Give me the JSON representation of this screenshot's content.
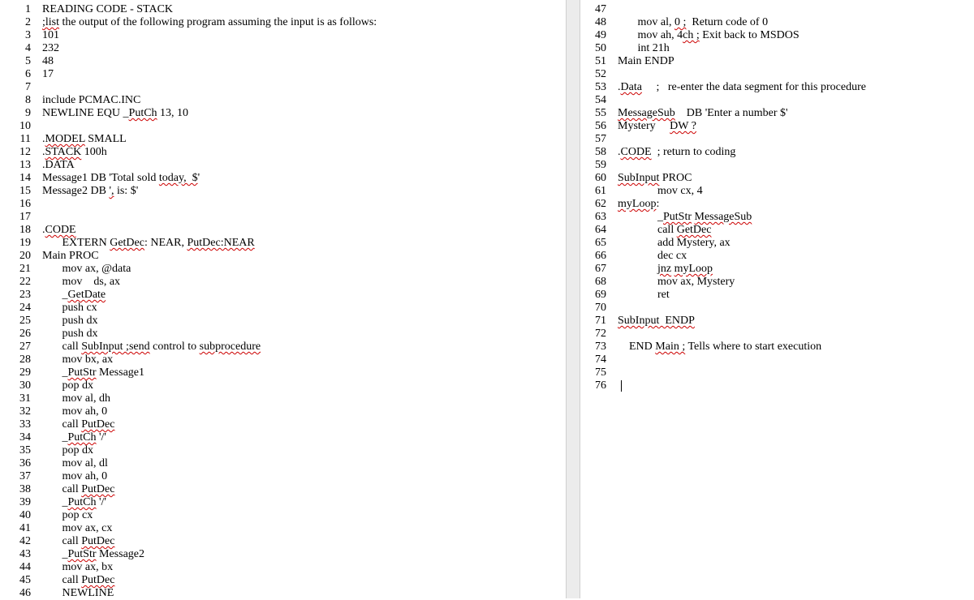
{
  "left": [
    {
      "n": 1,
      "segs": [
        {
          "t": "READING CODE - STACK"
        }
      ]
    },
    {
      "n": 2,
      "segs": [
        {
          "t": ";list",
          "u": 1
        },
        {
          "t": " the output of the following program assuming the input is as follows:"
        }
      ]
    },
    {
      "n": 3,
      "segs": [
        {
          "t": "101"
        }
      ]
    },
    {
      "n": 4,
      "segs": [
        {
          "t": "232"
        }
      ]
    },
    {
      "n": 5,
      "segs": [
        {
          "t": "48"
        }
      ]
    },
    {
      "n": 6,
      "segs": [
        {
          "t": "17"
        }
      ]
    },
    {
      "n": 7,
      "segs": [
        {
          "t": ""
        }
      ]
    },
    {
      "n": 8,
      "segs": [
        {
          "t": "include PCMAC.INC"
        }
      ]
    },
    {
      "n": 9,
      "segs": [
        {
          "t": "NEWLINE EQU _"
        },
        {
          "t": "PutCh",
          "u": 1
        },
        {
          "t": " 13, 10"
        }
      ]
    },
    {
      "n": 10,
      "segs": [
        {
          "t": ""
        }
      ]
    },
    {
      "n": 11,
      "segs": [
        {
          "t": "."
        },
        {
          "t": "MODEL",
          "u": 1
        },
        {
          "t": " SMALL"
        }
      ]
    },
    {
      "n": 12,
      "segs": [
        {
          "t": "."
        },
        {
          "t": "STACK",
          "u": 1
        },
        {
          "t": " 100h"
        }
      ]
    },
    {
      "n": 13,
      "segs": [
        {
          "t": ".DATA"
        }
      ]
    },
    {
      "n": 14,
      "segs": [
        {
          "t": "Message1 DB 'Total sold "
        },
        {
          "t": "today,  $",
          "u": 1
        },
        {
          "t": "'"
        }
      ]
    },
    {
      "n": 15,
      "segs": [
        {
          "t": "Message2 DB "
        },
        {
          "t": "',",
          "u": 1
        },
        {
          "t": " is: $'"
        }
      ]
    },
    {
      "n": 16,
      "segs": [
        {
          "t": ""
        }
      ]
    },
    {
      "n": 17,
      "segs": [
        {
          "t": ""
        }
      ]
    },
    {
      "n": 18,
      "segs": [
        {
          "t": "."
        },
        {
          "t": "CODE",
          "u": 1
        }
      ]
    },
    {
      "n": 19,
      "segs": [
        {
          "t": "       EXTERN "
        },
        {
          "t": "GetDec",
          "u": 1
        },
        {
          "t": ": NEAR, "
        },
        {
          "t": "PutDec:NEAR",
          "u": 1
        }
      ]
    },
    {
      "n": 20,
      "segs": [
        {
          "t": "Main PROC"
        }
      ]
    },
    {
      "n": 21,
      "segs": [
        {
          "t": "       mov ax, @data"
        }
      ]
    },
    {
      "n": 22,
      "segs": [
        {
          "t": "       mov    ds, ax"
        }
      ]
    },
    {
      "n": 23,
      "segs": [
        {
          "t": "       _"
        },
        {
          "t": "GetDate",
          "u": 1
        }
      ]
    },
    {
      "n": 24,
      "segs": [
        {
          "t": "       push cx"
        }
      ]
    },
    {
      "n": 25,
      "segs": [
        {
          "t": "       push dx"
        }
      ]
    },
    {
      "n": 26,
      "segs": [
        {
          "t": "       push dx"
        }
      ]
    },
    {
      "n": 27,
      "segs": [
        {
          "t": "       call "
        },
        {
          "t": "SubInput ;send",
          "u": 1
        },
        {
          "t": " control to "
        },
        {
          "t": "subprocedure",
          "u": 1
        }
      ]
    },
    {
      "n": 28,
      "segs": [
        {
          "t": "       mov bx, ax"
        }
      ]
    },
    {
      "n": 29,
      "segs": [
        {
          "t": "       _"
        },
        {
          "t": "PutStr",
          "u": 1
        },
        {
          "t": " Message1"
        }
      ]
    },
    {
      "n": 30,
      "segs": [
        {
          "t": "       pop dx"
        }
      ]
    },
    {
      "n": 31,
      "segs": [
        {
          "t": "       mov al, dh"
        }
      ]
    },
    {
      "n": 32,
      "segs": [
        {
          "t": "       mov ah, 0"
        }
      ]
    },
    {
      "n": 33,
      "segs": [
        {
          "t": "       call "
        },
        {
          "t": "PutDec",
          "u": 1
        }
      ]
    },
    {
      "n": 34,
      "segs": [
        {
          "t": "       _"
        },
        {
          "t": "PutCh",
          "u": 1
        },
        {
          "t": " '/'"
        }
      ]
    },
    {
      "n": 35,
      "segs": [
        {
          "t": "       pop dx"
        }
      ]
    },
    {
      "n": 36,
      "segs": [
        {
          "t": "       mov al, dl"
        }
      ]
    },
    {
      "n": 37,
      "segs": [
        {
          "t": "       mov ah, 0"
        }
      ]
    },
    {
      "n": 38,
      "segs": [
        {
          "t": "       call "
        },
        {
          "t": "PutDec",
          "u": 1
        }
      ]
    },
    {
      "n": 39,
      "segs": [
        {
          "t": "       _"
        },
        {
          "t": "PutCh",
          "u": 1
        },
        {
          "t": " '/'"
        }
      ]
    },
    {
      "n": 40,
      "segs": [
        {
          "t": "       pop cx"
        }
      ]
    },
    {
      "n": 41,
      "segs": [
        {
          "t": "       mov ax, cx"
        }
      ]
    },
    {
      "n": 42,
      "segs": [
        {
          "t": "       call "
        },
        {
          "t": "PutDec",
          "u": 1
        }
      ]
    },
    {
      "n": 43,
      "segs": [
        {
          "t": "       _"
        },
        {
          "t": "PutStr",
          "u": 1
        },
        {
          "t": " Message2"
        }
      ]
    },
    {
      "n": 44,
      "segs": [
        {
          "t": "       mov ax, bx"
        }
      ]
    },
    {
      "n": 45,
      "segs": [
        {
          "t": "       call "
        },
        {
          "t": "PutDec",
          "u": 1
        }
      ]
    },
    {
      "n": 46,
      "segs": [
        {
          "t": "       NEWLINE"
        }
      ]
    }
  ],
  "right": [
    {
      "n": 47,
      "segs": [
        {
          "t": ""
        }
      ]
    },
    {
      "n": 48,
      "segs": [
        {
          "t": "       mov al, "
        },
        {
          "t": "0 ;",
          "u": 1
        },
        {
          "t": "  Return code of 0"
        }
      ]
    },
    {
      "n": 49,
      "segs": [
        {
          "t": "       mov ah, 4"
        },
        {
          "t": "ch ;",
          "u": 1
        },
        {
          "t": " Exit back to MSDOS"
        }
      ]
    },
    {
      "n": 50,
      "segs": [
        {
          "t": "       int 21h"
        }
      ]
    },
    {
      "n": 51,
      "segs": [
        {
          "t": "Main ENDP"
        }
      ]
    },
    {
      "n": 52,
      "segs": [
        {
          "t": ""
        }
      ]
    },
    {
      "n": 53,
      "segs": [
        {
          "t": "."
        },
        {
          "t": "Data",
          "u": 1
        },
        {
          "t": "     ;   re-enter the data segment for this procedure"
        }
      ]
    },
    {
      "n": 54,
      "segs": [
        {
          "t": ""
        }
      ]
    },
    {
      "n": 55,
      "segs": [
        {
          "t": ""
        },
        {
          "t": "MessageSub",
          "u": 1
        },
        {
          "t": "    DB 'Enter a number $'"
        }
      ]
    },
    {
      "n": 56,
      "segs": [
        {
          "t": "Mystery     "
        },
        {
          "t": "DW ?",
          "u": 1
        }
      ]
    },
    {
      "n": 57,
      "segs": [
        {
          "t": ""
        }
      ]
    },
    {
      "n": 58,
      "segs": [
        {
          "t": "."
        },
        {
          "t": "CODE",
          "u": 1
        },
        {
          "t": "  ; return to coding"
        }
      ]
    },
    {
      "n": 59,
      "segs": [
        {
          "t": ""
        }
      ]
    },
    {
      "n": 60,
      "segs": [
        {
          "t": ""
        },
        {
          "t": "SubInput",
          "u": 1
        },
        {
          "t": " PROC"
        }
      ]
    },
    {
      "n": 61,
      "segs": [
        {
          "t": "              mov cx, 4"
        }
      ]
    },
    {
      "n": 62,
      "segs": [
        {
          "t": ""
        },
        {
          "t": "myLoop",
          "u": 1
        },
        {
          "t": ":"
        }
      ]
    },
    {
      "n": 63,
      "segs": [
        {
          "t": "              _"
        },
        {
          "t": "PutStr",
          "u": 1
        },
        {
          "t": " "
        },
        {
          "t": "MessageSub",
          "u": 1
        }
      ]
    },
    {
      "n": 64,
      "segs": [
        {
          "t": "              call "
        },
        {
          "t": "GetDec",
          "u": 1
        }
      ]
    },
    {
      "n": 65,
      "segs": [
        {
          "t": "              add Mystery, ax"
        }
      ]
    },
    {
      "n": 66,
      "segs": [
        {
          "t": "              dec cx"
        }
      ]
    },
    {
      "n": 67,
      "segs": [
        {
          "t": "              "
        },
        {
          "t": "jnz",
          "u": 1
        },
        {
          "t": " "
        },
        {
          "t": "myLoop",
          "u": 1
        }
      ]
    },
    {
      "n": 68,
      "segs": [
        {
          "t": "              mov ax, Mystery"
        }
      ]
    },
    {
      "n": 69,
      "segs": [
        {
          "t": "              ret"
        }
      ]
    },
    {
      "n": 70,
      "segs": [
        {
          "t": ""
        }
      ]
    },
    {
      "n": 71,
      "segs": [
        {
          "t": ""
        },
        {
          "t": "SubInput  ENDP",
          "u": 1
        }
      ]
    },
    {
      "n": 72,
      "segs": [
        {
          "t": ""
        }
      ]
    },
    {
      "n": 73,
      "segs": [
        {
          "t": "    END "
        },
        {
          "t": "Main ;",
          "u": 1
        },
        {
          "t": " Tells where to start execution"
        }
      ]
    },
    {
      "n": 74,
      "segs": [
        {
          "t": ""
        }
      ]
    },
    {
      "n": 75,
      "segs": [
        {
          "t": ""
        }
      ]
    },
    {
      "n": 76,
      "segs": [
        {
          "t": ""
        }
      ],
      "cursor": true
    }
  ]
}
